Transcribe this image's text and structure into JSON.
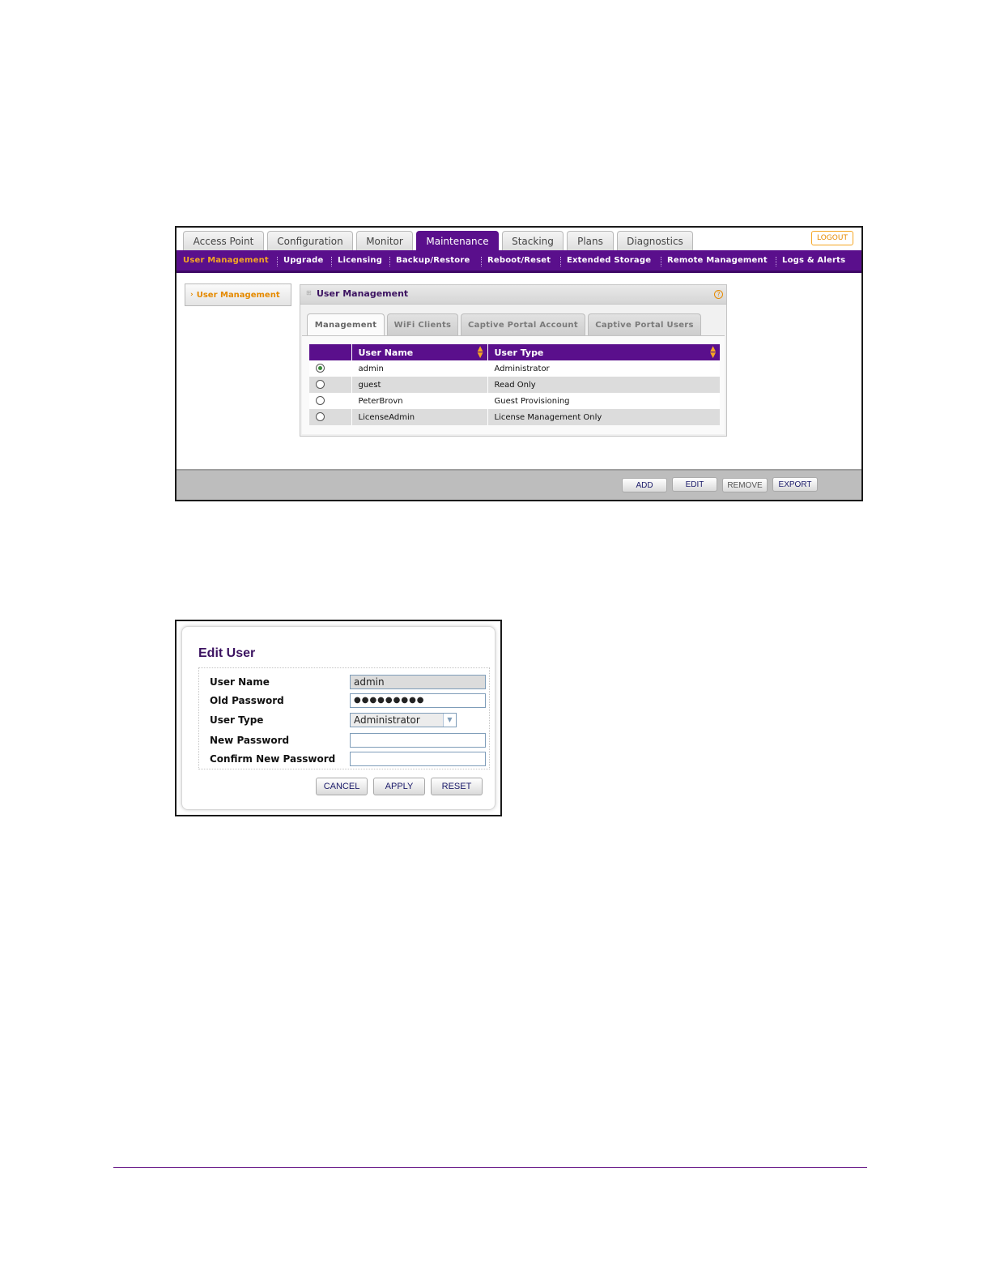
{
  "user_management": {
    "main_tabs": [
      "Access Point",
      "Configuration",
      "Monitor",
      "Maintenance",
      "Stacking",
      "Plans",
      "Diagnostics"
    ],
    "logout_label": "LOGOUT",
    "sub_nav": [
      "User Management",
      "Upgrade",
      "Licensing",
      "Backup/Restore",
      "Reboot/Reset",
      "Extended Storage",
      "Remote Management",
      "Logs & Alerts"
    ],
    "side_item": "User Management",
    "panel_title": "User Management",
    "sub_tabs": [
      "Management",
      "WiFi Clients",
      "Captive Portal Account",
      "Captive Portal Users"
    ],
    "table": {
      "headers": [
        "User Name",
        "User Type"
      ],
      "rows": [
        {
          "name": "admin",
          "type": "Administrator",
          "selected": true
        },
        {
          "name": "guest",
          "type": "Read Only",
          "selected": false
        },
        {
          "name": "PeterBrovn",
          "type": "Guest Provisioning",
          "selected": false
        },
        {
          "name": "LicenseAdmin",
          "type": "License Management Only",
          "selected": false
        }
      ]
    },
    "buttons": {
      "add": "ADD",
      "edit": "EDIT",
      "remove": "REMOVE",
      "export": "EXPORT"
    }
  },
  "edit_user": {
    "title": "Edit User",
    "labels": {
      "user_name": "User Name",
      "old_password": "Old Password",
      "user_type": "User Type",
      "new_password": "New Password",
      "confirm_new_password": "Confirm New Password"
    },
    "values": {
      "user_name": "admin",
      "old_password": "●●●●●●●●●",
      "user_type": "Administrator",
      "new_password": "",
      "confirm_new_password": ""
    },
    "buttons": {
      "cancel": "CANCEL",
      "apply": "APPLY",
      "reset": "RESET"
    }
  },
  "colors": {
    "brand_purple": "#5a0f8c",
    "accent_orange": "#f5a623"
  }
}
